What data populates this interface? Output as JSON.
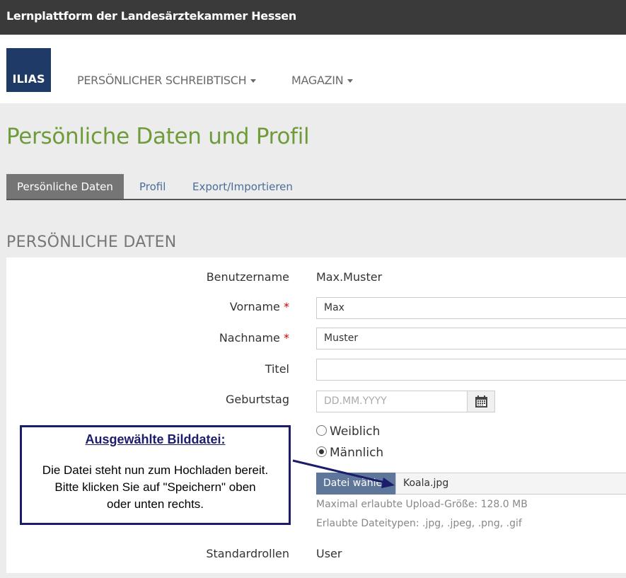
{
  "topbar": {
    "title": "Lernplattform der Landesärztekammer Hessen"
  },
  "header": {
    "logo": "ILIAS",
    "nav": [
      {
        "label": "PERSÖNLICHER SCHREIBTISCH"
      },
      {
        "label": "MAGAZIN"
      }
    ]
  },
  "page": {
    "title": "Persönliche Daten und Profil"
  },
  "tabs": [
    {
      "label": "Persönliche Daten"
    },
    {
      "label": "Profil"
    },
    {
      "label": "Export/Importieren"
    }
  ],
  "section": {
    "title": "PERSÖNLICHE DATEN"
  },
  "form": {
    "username_label": "Benutzername",
    "username_value": "Max.Muster",
    "firstname_label": "Vorname",
    "firstname_value": "Max",
    "lastname_label": "Nachname",
    "lastname_value": "Muster",
    "required_mark": "*",
    "title_label": "Titel",
    "title_value": "",
    "birthday_label": "Geburtstag",
    "birthday_placeholder": "DD.MM.YYYY",
    "gender_female": "Weiblich",
    "gender_male": "Männlich",
    "gender_selected": "Männlich",
    "file_button": "Datei wählen",
    "file_name": "Koala.jpg",
    "max_upload": "Maximal erlaubte Upload-Größe: 128.0 MB",
    "allowed_types": "Erlaubte Dateitypen: .jpg, .jpeg, .png, .gif",
    "roles_label": "Standardrollen",
    "roles_value": "User"
  },
  "callout": {
    "heading": "Ausgewählte Bilddatei:",
    "line1": "Die Datei steht nun zum Hochladen bereit.",
    "line2": "Bitte klicken Sie auf \"Speichern\" oben",
    "line3": "oder unten rechts."
  },
  "colors": {
    "topbar": "#3a3a3a",
    "title": "#6f9c3a",
    "tab_active": "#757575",
    "link": "#4b6d9a",
    "required": "#cc0000",
    "callout_border": "#1c1c6c"
  },
  "icons": {
    "calendar": "calendar-icon",
    "caret": "chevron-down-icon"
  }
}
